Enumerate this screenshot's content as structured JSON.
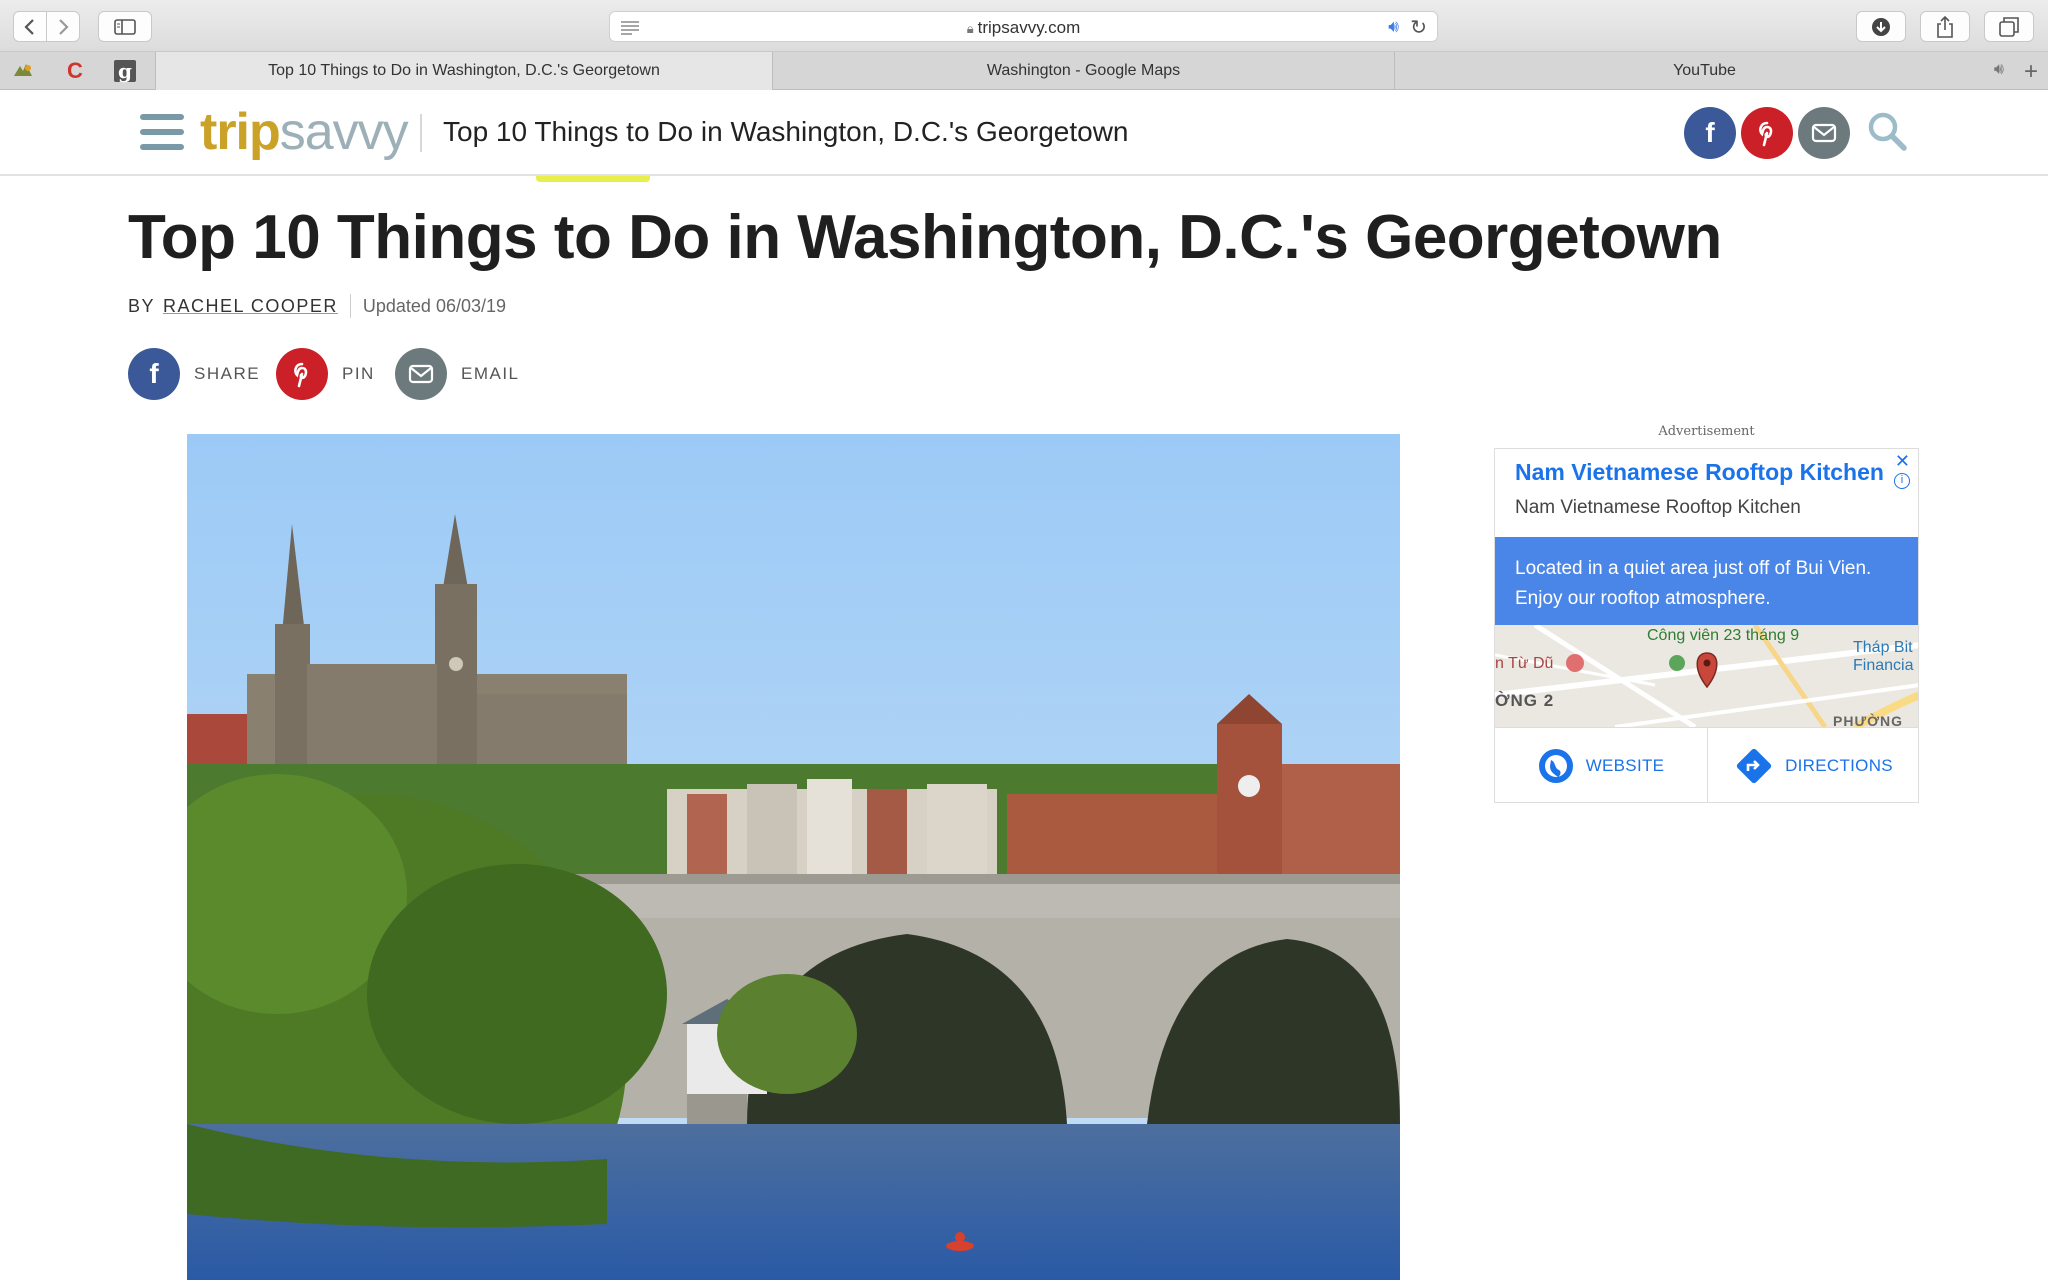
{
  "browser": {
    "url": "tripsavvy.com",
    "tabs": [
      {
        "label": "Top 10 Things to Do in Washington, D.C.'s Georgetown",
        "active": true
      },
      {
        "label": "Washington - Google Maps",
        "active": false
      },
      {
        "label": "YouTube",
        "active": false
      }
    ],
    "favorites": [
      "pinned-site",
      "C",
      "g"
    ]
  },
  "site": {
    "logo_trip": "trip",
    "logo_savvy": "savvy",
    "header_title": "Top 10 Things to Do in Washington, D.C.'s Georgetown",
    "colors": {
      "facebook": "#3b5998",
      "pinterest": "#cb2027",
      "email": "#6d7a7d",
      "search": "#9bbcc8",
      "accent": "#c9a227"
    }
  },
  "article": {
    "title": "Top 10 Things to Do in Washington, D.C.'s Georgetown",
    "by_label": "BY",
    "author": "Rachel Cooper",
    "updated": "Updated 06/03/19",
    "share": [
      {
        "icon": "facebook-icon",
        "label": "SHARE"
      },
      {
        "icon": "pinterest-icon",
        "label": "PIN"
      },
      {
        "icon": "email-icon",
        "label": "EMAIL"
      }
    ]
  },
  "ad": {
    "label": "Advertisement",
    "headline": "Nam Vietnamese Rooftop Kitchen",
    "subhead": "Nam Vietnamese Rooftop Kitchen",
    "body_line1": "Located in a quiet area just off of Bui Vien.",
    "body_line2": "Enjoy our rooftop atmosphere.",
    "map_labels": {
      "park": "Công viên 23 tháng 9",
      "left": "n Từ Dũ",
      "district": "ỜNG 2",
      "right1": "Tháp Bit",
      "right2": "Financia",
      "bottom": "PHƯỜNG"
    },
    "website_label": "WEBSITE",
    "directions_label": "DIRECTIONS"
  }
}
